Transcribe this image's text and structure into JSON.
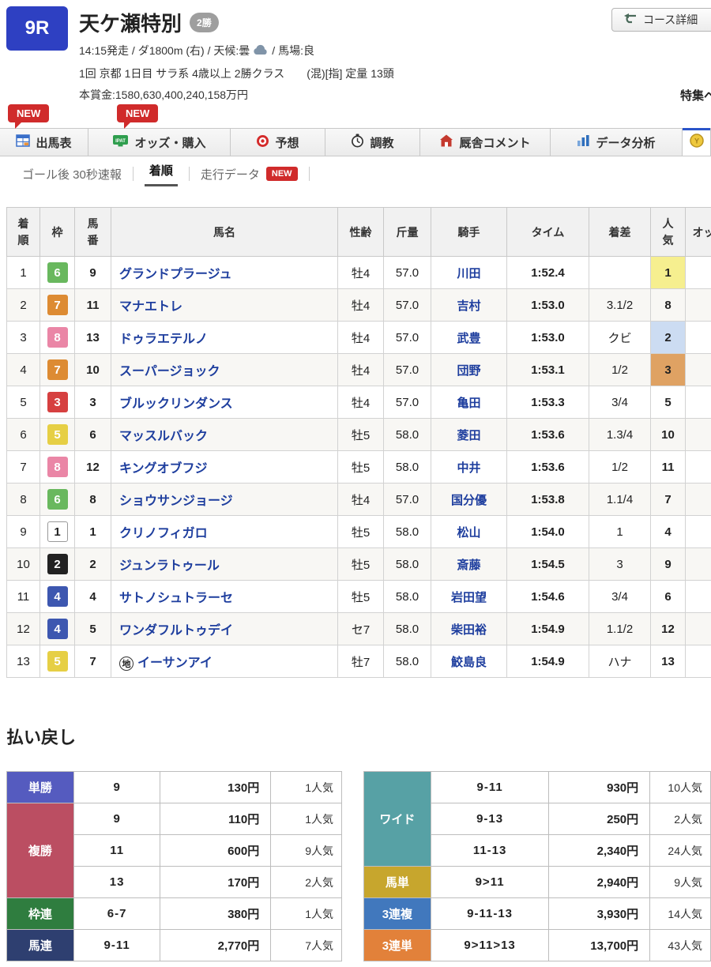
{
  "header": {
    "race_number": "9R",
    "title": "天ケ瀬特別",
    "grade_badge": "2勝",
    "start_info": "14:15発走 / ダ1800m (右) / 天候:曇",
    "going_info": "/ 馬場:良",
    "weather_icon": "cloud-icon",
    "condition_line": "1回 京都 1日目 サラ系 4歳以上 2勝クラス　　(混)[指] 定量 13頭",
    "prize_line": "本賞金:1580,630,400,240,158万円",
    "course_detail_label": "コース詳細",
    "course_icon": "course-icon",
    "special_link_label": "特集ペ",
    "new_badge_label": "NEW"
  },
  "tabs": [
    {
      "label": "出馬表",
      "icon": "racecard-table-icon",
      "new": true,
      "active": false
    },
    {
      "label": "オッズ・購入",
      "icon": "ipat-icon",
      "new": true,
      "active": false
    },
    {
      "label": "予想",
      "icon": "target-icon",
      "new": false,
      "active": false
    },
    {
      "label": "調教",
      "icon": "stopwatch-icon",
      "new": false,
      "active": false
    },
    {
      "label": "厩舎コメント",
      "icon": "barn-icon",
      "new": false,
      "active": false
    },
    {
      "label": "データ分析",
      "icon": "chart-icon",
      "new": false,
      "active": false
    },
    {
      "label": "",
      "icon": "coin-icon",
      "new": false,
      "active": true
    }
  ],
  "subnav": [
    {
      "label": "ゴール後 30秒速報",
      "active": false,
      "new": false
    },
    {
      "label": "着順",
      "active": true,
      "new": false
    },
    {
      "label": "走行データ",
      "active": false,
      "new": true
    }
  ],
  "results_table": {
    "headers": {
      "rank": "着順",
      "frame": "枠",
      "number": "馬番",
      "name": "馬名",
      "sex_age": "性齢",
      "weight": "斤量",
      "jockey": "騎手",
      "time": "タイム",
      "margin": "着差",
      "popularity": "人気",
      "odds": "オッズ"
    },
    "rows": [
      {
        "rank": 1,
        "frame": 6,
        "number": 9,
        "name": "グランドプラージュ",
        "mark": "",
        "sex_age": "牡4",
        "weight": "57.0",
        "jockey": "川田",
        "time": "1:52.4",
        "margin": "",
        "popularity": 1
      },
      {
        "rank": 2,
        "frame": 7,
        "number": 11,
        "name": "マナエトレ",
        "mark": "",
        "sex_age": "牡4",
        "weight": "57.0",
        "jockey": "吉村",
        "time": "1:53.0",
        "margin": "3.1/2",
        "popularity": 8
      },
      {
        "rank": 3,
        "frame": 8,
        "number": 13,
        "name": "ドゥラエテルノ",
        "mark": "",
        "sex_age": "牡4",
        "weight": "57.0",
        "jockey": "武豊",
        "time": "1:53.0",
        "margin": "クビ",
        "popularity": 2
      },
      {
        "rank": 4,
        "frame": 7,
        "number": 10,
        "name": "スーパージョック",
        "mark": "",
        "sex_age": "牡4",
        "weight": "57.0",
        "jockey": "団野",
        "time": "1:53.1",
        "margin": "1/2",
        "popularity": 3
      },
      {
        "rank": 5,
        "frame": 3,
        "number": 3,
        "name": "ブルックリンダンス",
        "mark": "",
        "sex_age": "牡4",
        "weight": "57.0",
        "jockey": "亀田",
        "time": "1:53.3",
        "margin": "3/4",
        "popularity": 5
      },
      {
        "rank": 6,
        "frame": 5,
        "number": 6,
        "name": "マッスルバック",
        "mark": "",
        "sex_age": "牡5",
        "weight": "58.0",
        "jockey": "菱田",
        "time": "1:53.6",
        "margin": "1.3/4",
        "popularity": 10
      },
      {
        "rank": 7,
        "frame": 8,
        "number": 12,
        "name": "キングオブフジ",
        "mark": "",
        "sex_age": "牡5",
        "weight": "58.0",
        "jockey": "中井",
        "time": "1:53.6",
        "margin": "1/2",
        "popularity": 11
      },
      {
        "rank": 8,
        "frame": 6,
        "number": 8,
        "name": "ショウサンジョージ",
        "mark": "",
        "sex_age": "牡4",
        "weight": "57.0",
        "jockey": "国分優",
        "time": "1:53.8",
        "margin": "1.1/4",
        "popularity": 7
      },
      {
        "rank": 9,
        "frame": 1,
        "number": 1,
        "name": "クリノフィガロ",
        "mark": "",
        "sex_age": "牡5",
        "weight": "58.0",
        "jockey": "松山",
        "time": "1:54.0",
        "margin": "1",
        "popularity": 4
      },
      {
        "rank": 10,
        "frame": 2,
        "number": 2,
        "name": "ジュンラトゥール",
        "mark": "",
        "sex_age": "牡5",
        "weight": "58.0",
        "jockey": "斎藤",
        "time": "1:54.5",
        "margin": "3",
        "popularity": 9
      },
      {
        "rank": 11,
        "frame": 4,
        "number": 4,
        "name": "サトノシュトラーセ",
        "mark": "",
        "sex_age": "牡5",
        "weight": "58.0",
        "jockey": "岩田望",
        "time": "1:54.6",
        "margin": "3/4",
        "popularity": 6
      },
      {
        "rank": 12,
        "frame": 4,
        "number": 5,
        "name": "ワンダフルトゥデイ",
        "mark": "",
        "sex_age": "セ7",
        "weight": "58.0",
        "jockey": "柴田裕",
        "time": "1:54.9",
        "margin": "1.1/2",
        "popularity": 12
      },
      {
        "rank": 13,
        "frame": 5,
        "number": 7,
        "name": "イーサンアイ",
        "mark": "地",
        "sex_age": "牡7",
        "weight": "58.0",
        "jockey": "鮫島良",
        "time": "1:54.9",
        "margin": "ハナ",
        "popularity": 13
      }
    ]
  },
  "frame_styles": {
    "1": {
      "bg": "#ffffff",
      "fg": "#222222",
      "border": true
    },
    "2": {
      "bg": "#222222",
      "fg": "#ffffff",
      "border": false
    },
    "3": {
      "bg": "#d64040",
      "fg": "#ffffff",
      "border": false
    },
    "4": {
      "bg": "#3d57b0",
      "fg": "#ffffff",
      "border": false
    },
    "5": {
      "bg": "#e6cf45",
      "fg": "#ffffff",
      "border": false
    },
    "6": {
      "bg": "#69b85e",
      "fg": "#ffffff",
      "border": false
    },
    "7": {
      "bg": "#dd8b33",
      "fg": "#ffffff",
      "border": false
    },
    "8": {
      "bg": "#ea86a6",
      "fg": "#ffffff",
      "border": false
    }
  },
  "popularity_highlight": {
    "1": "#f6ef8f",
    "2": "#ccdcf2",
    "3": "#dfa263"
  },
  "payout": {
    "heading": "払い戻し",
    "left_groups": [
      {
        "label": "単勝",
        "color": "#555bbf",
        "rows": [
          {
            "combo": "9",
            "amount": "130円",
            "pop": "1人気"
          }
        ]
      },
      {
        "label": "複勝",
        "color": "#bb4e62",
        "rows": [
          {
            "combo": "9",
            "amount": "110円",
            "pop": "1人気"
          },
          {
            "combo": "11",
            "amount": "600円",
            "pop": "9人気"
          },
          {
            "combo": "13",
            "amount": "170円",
            "pop": "2人気"
          }
        ]
      },
      {
        "label": "枠連",
        "color": "#2f7d3f",
        "rows": [
          {
            "combo": "6-7",
            "amount": "380円",
            "pop": "1人気"
          }
        ]
      },
      {
        "label": "馬連",
        "color": "#2e3f70",
        "rows": [
          {
            "combo": "9-11",
            "amount": "2,770円",
            "pop": "7人気"
          }
        ]
      }
    ],
    "right_groups": [
      {
        "label": "ワイド",
        "color": "#57a1a5",
        "rows": [
          {
            "combo": "9-11",
            "amount": "930円",
            "pop": "10人気"
          },
          {
            "combo": "9-13",
            "amount": "250円",
            "pop": "2人気"
          },
          {
            "combo": "11-13",
            "amount": "2,340円",
            "pop": "24人気"
          }
        ]
      },
      {
        "label": "馬単",
        "color": "#c7a62d",
        "rows": [
          {
            "combo": "9>11",
            "amount": "2,940円",
            "pop": "9人気"
          }
        ]
      },
      {
        "label": "3連複",
        "color": "#4178bd",
        "rows": [
          {
            "combo": "9-11-13",
            "amount": "3,930円",
            "pop": "14人気"
          }
        ]
      },
      {
        "label": "3連単",
        "color": "#e2813a",
        "rows": [
          {
            "combo": "9>11>13",
            "amount": "13,700円",
            "pop": "43人気"
          }
        ]
      }
    ]
  }
}
